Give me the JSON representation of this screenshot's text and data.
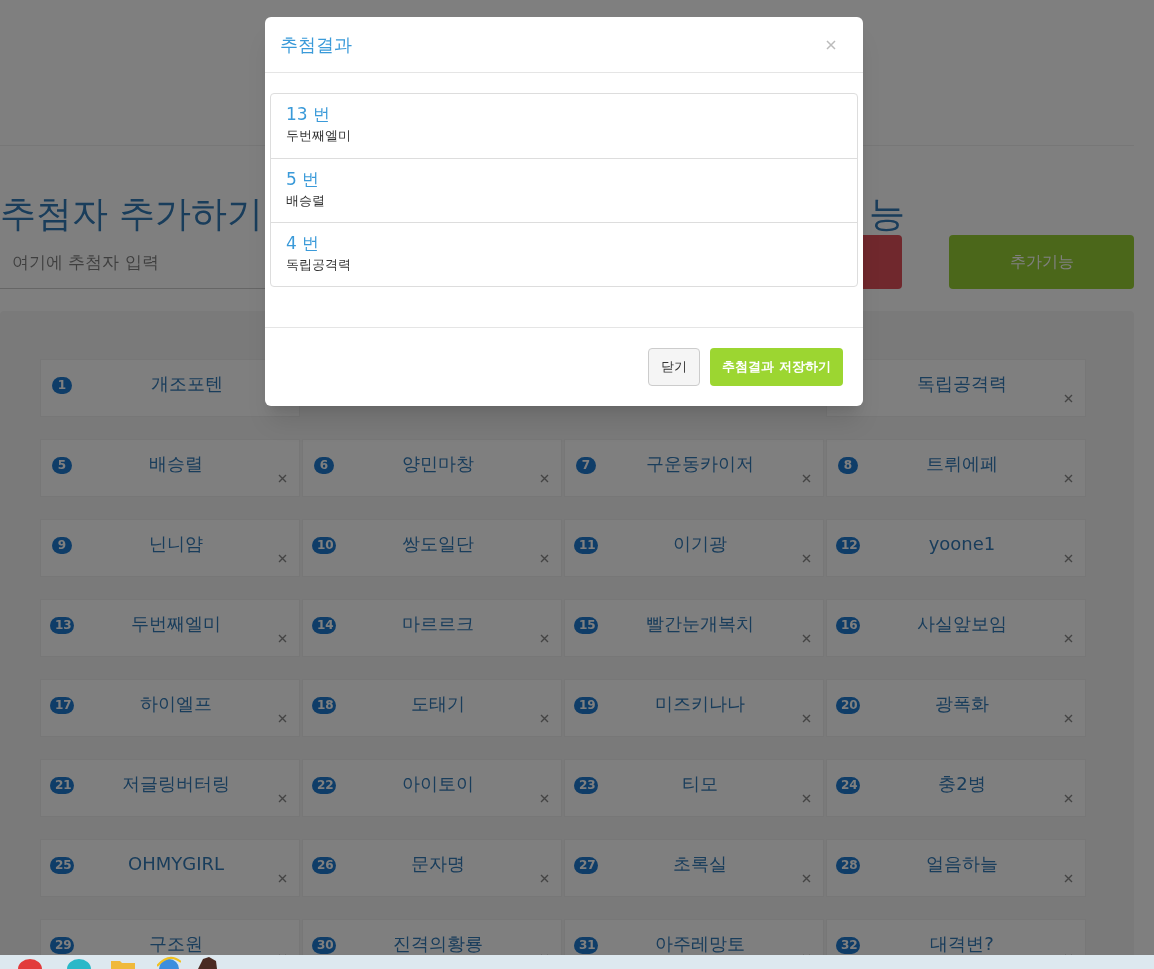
{
  "page": {
    "heading": "추첨자 추가하기",
    "heading_right": "능",
    "input": {
      "placeholder": "여기에 추첨자 입력"
    },
    "extra_button": "추가기능"
  },
  "participants": [
    {
      "number": "1",
      "name": "개조포텐"
    },
    {
      "name": "독립공격력"
    },
    {
      "number": "5",
      "name": "배승렬"
    },
    {
      "number": "6",
      "name": "양민마창"
    },
    {
      "number": "7",
      "name": "구운동카이저"
    },
    {
      "number": "8",
      "name": "트뤼에페"
    },
    {
      "number": "9",
      "name": "닌니얌"
    },
    {
      "number": "10",
      "name": "쌍도일단"
    },
    {
      "number": "11",
      "name": "이기광"
    },
    {
      "number": "12",
      "name": "yoone1"
    },
    {
      "number": "13",
      "name": "두번째엘미"
    },
    {
      "number": "14",
      "name": "마르르크"
    },
    {
      "number": "15",
      "name": "빨간눈개복치"
    },
    {
      "number": "16",
      "name": "사실앞보임"
    },
    {
      "number": "17",
      "name": "하이엘프"
    },
    {
      "number": "18",
      "name": "도태기"
    },
    {
      "number": "19",
      "name": "미즈키나나"
    },
    {
      "number": "20",
      "name": "광폭화"
    },
    {
      "number": "21",
      "name": "저글링버터링"
    },
    {
      "number": "22",
      "name": "아이토이"
    },
    {
      "number": "23",
      "name": "티모"
    },
    {
      "number": "24",
      "name": "충2병"
    },
    {
      "number": "25",
      "name": "OHMYGIRL"
    },
    {
      "number": "26",
      "name": "문자명"
    },
    {
      "number": "27",
      "name": "초록실"
    },
    {
      "number": "28",
      "name": "얼음하늘"
    },
    {
      "number": "29",
      "name": "구조원"
    },
    {
      "number": "30",
      "name": "진격의황룡"
    },
    {
      "number": "31",
      "name": "아주레망토"
    },
    {
      "number": "32",
      "name": "대격변?"
    }
  ],
  "modal": {
    "title": "추첨결과",
    "results": [
      {
        "number": "13 번",
        "name": "두번째엘미"
      },
      {
        "number": "5 번",
        "name": "배승렬"
      },
      {
        "number": "4 번",
        "name": "독립공격력"
      }
    ],
    "buttons": [
      {
        "kind": "default",
        "label": "닫기"
      },
      {
        "kind": "primary",
        "label": "추첨결과 저장하기"
      }
    ]
  }
}
